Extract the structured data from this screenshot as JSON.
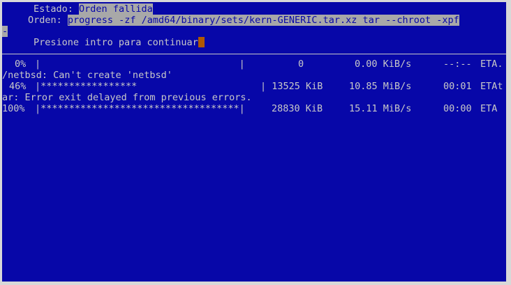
{
  "status": {
    "label": "Estado:",
    "value": "Orden fallida"
  },
  "command": {
    "label": "Orden:",
    "value_line1": "progress -zf /amd64/binary/sets/kern-GENERIC.tar.xz tar --chroot -xpf",
    "value_line2": "-"
  },
  "prompt": {
    "text": "Presione intro para continuar"
  },
  "output": {
    "progress_rows": [
      {
        "percent": "0%",
        "bar": "|                                   |",
        "size": "0",
        "rate": "0.00 KiB/s",
        "time": "--:--",
        "eta": "ETA."
      },
      {
        "percent": "46%",
        "bar": "|*****************",
        "size": "| 13525 KiB",
        "rate": "10.85 MiB/s",
        "time": "00:01",
        "eta": "ETAt"
      },
      {
        "percent": "100%",
        "bar": "|***********************************|",
        "size": "28830 KiB",
        "rate": "15.11 MiB/s",
        "time": "00:00",
        "eta": "ETA"
      }
    ],
    "messages": [
      "/netbsd: Can't create 'netbsd'",
      "ar: Error exit delayed from previous errors."
    ]
  }
}
